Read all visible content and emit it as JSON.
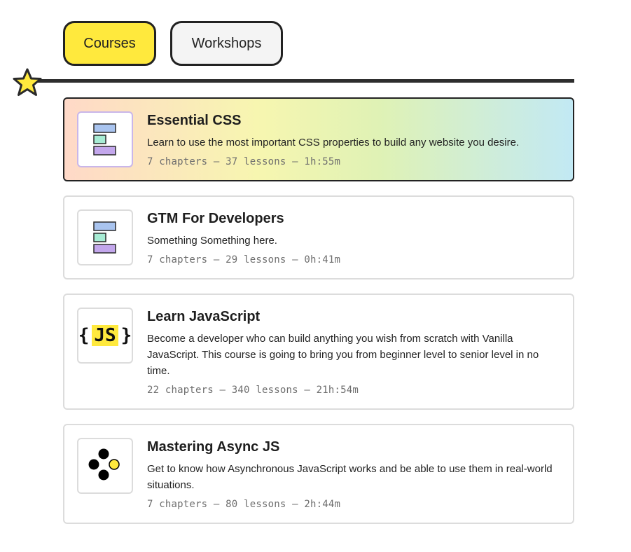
{
  "tabs": [
    {
      "label": "Courses",
      "active": true
    },
    {
      "label": "Workshops",
      "active": false
    }
  ],
  "colors": {
    "accent_yellow": "#ffe93d",
    "block_blue": "#a9c4ef",
    "block_mint": "#a7ecd4",
    "block_purple": "#c3a7ec"
  },
  "courses": [
    {
      "title": "Essential CSS",
      "description": "Learn to use the most important CSS properties to build any website you desire.",
      "meta": "7 chapters — 37 lessons — 1h:55m",
      "icon": "css-blocks-icon",
      "highlighted": true
    },
    {
      "title": "GTM For Developers",
      "description": "Something Something here.",
      "meta": "7 chapters — 29 lessons — 0h:41m",
      "icon": "css-blocks-icon",
      "highlighted": false
    },
    {
      "title": "Learn JavaScript",
      "description": "Become a developer who can build anything you wish from scratch with Vanilla JavaScript. This course is going to bring you from beginner level to senior level in no time.",
      "meta": "22 chapters — 340 lessons — 21h:54m",
      "icon": "js-braces-icon",
      "icon_text": {
        "open": "{",
        "badge": "JS",
        "close": "}"
      },
      "highlighted": false
    },
    {
      "title": "Mastering Async JS",
      "description": "Get to know how Asynchronous JavaScript works and be able to use them in real-world situations.",
      "meta": "7 chapters — 80 lessons — 2h:44m",
      "icon": "async-dots-icon",
      "highlighted": false
    }
  ]
}
